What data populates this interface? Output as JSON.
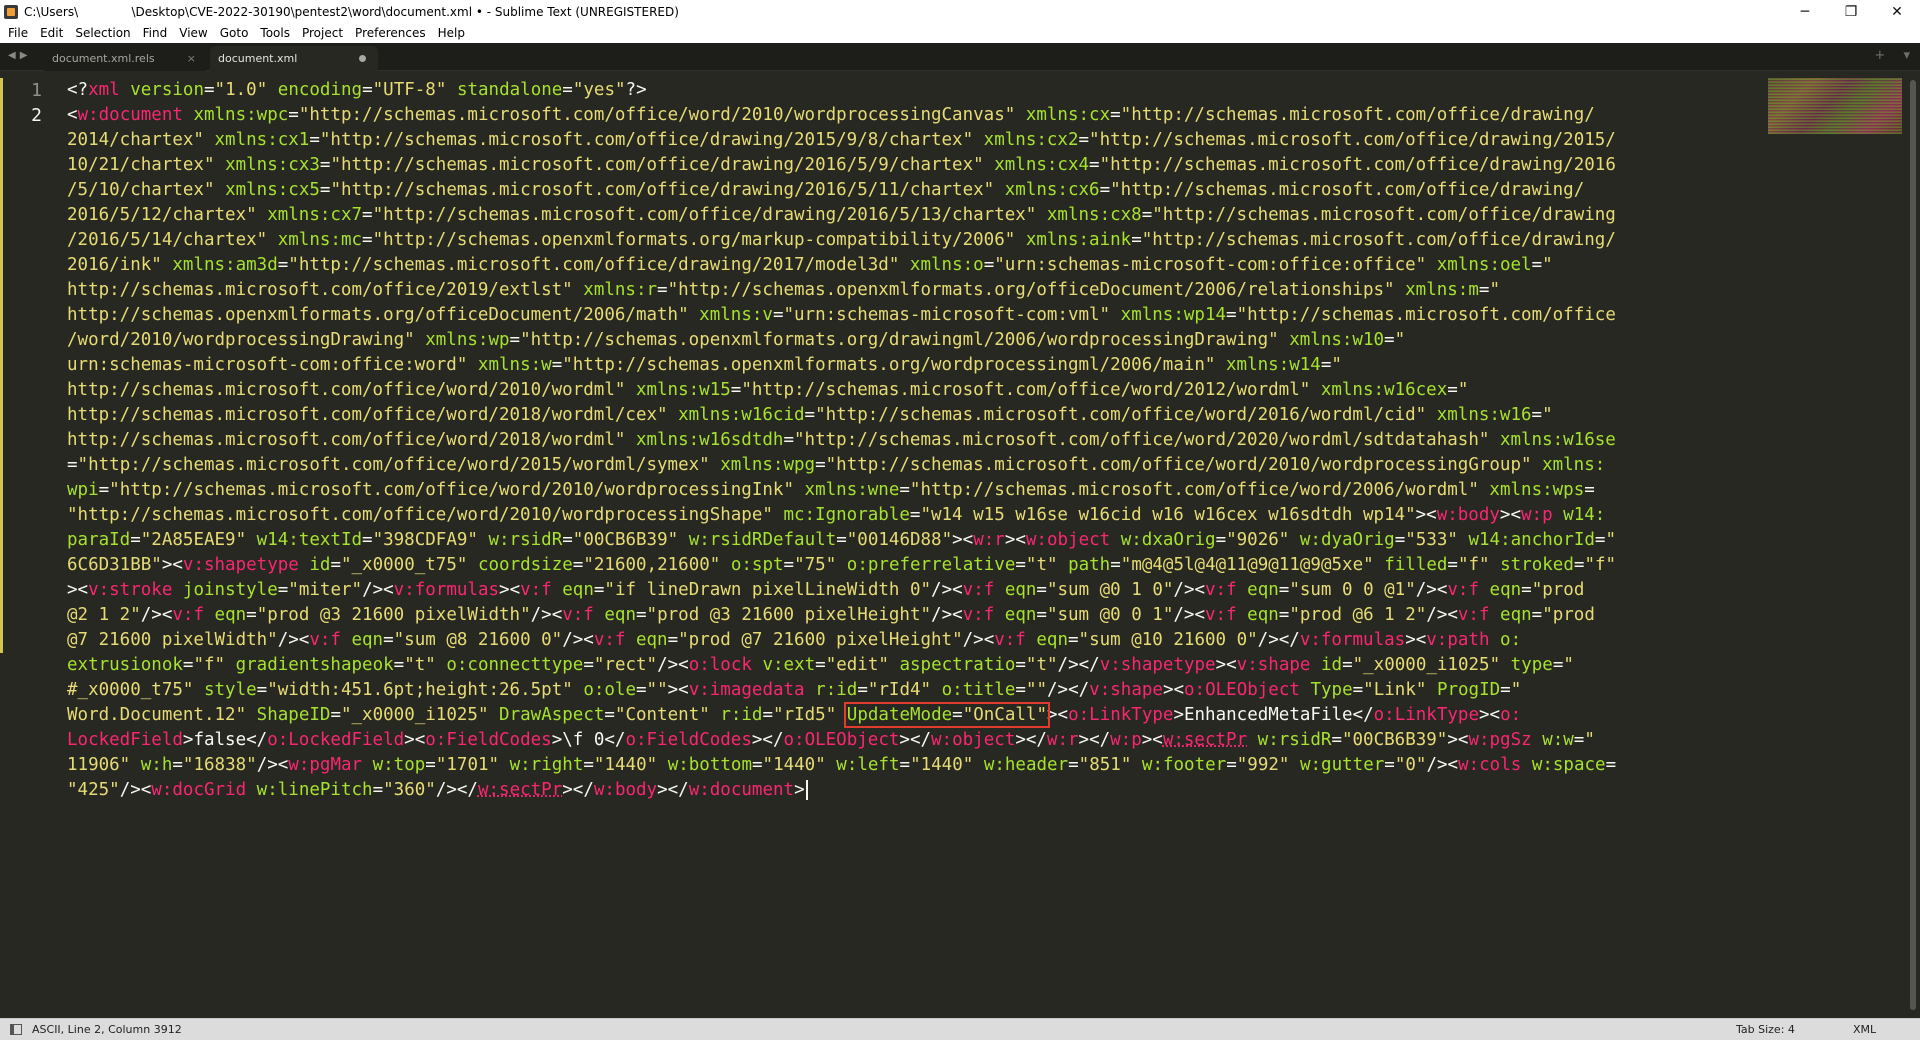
{
  "window": {
    "title": "C:\\Users\\              \\Desktop\\CVE-2022-30190\\pentest2\\word\\document.xml • - Sublime Text (UNREGISTERED)",
    "controls": {
      "minimize": "─",
      "maximize": "❐",
      "close": "✕"
    }
  },
  "menu": [
    "File",
    "Edit",
    "Selection",
    "Find",
    "View",
    "Goto",
    "Tools",
    "Project",
    "Preferences",
    "Help"
  ],
  "tabs": [
    {
      "label": "document.xml.rels",
      "active": false,
      "close": "×"
    },
    {
      "label": "document.xml",
      "active": true,
      "dirty": true
    }
  ],
  "tab_bar": {
    "nav": "◀▶",
    "new_tab": "+",
    "overflow": "▾"
  },
  "editor": {
    "line_numbers": [
      "1",
      "2"
    ],
    "current_line": "2",
    "highlight": "UpdateMode=\"OnCall\""
  },
  "status": {
    "position": "ASCII, Line 2, Column 3912",
    "tab_size": "Tab Size: 4",
    "syntax": "XML"
  },
  "colors": {
    "background": "#272822",
    "tag": "#f92672",
    "attribute": "#a6e22e",
    "string": "#e6db74",
    "text": "#f8f8f2",
    "highlight_border": "#e33c2f",
    "modified_marker": "#d6c452"
  }
}
